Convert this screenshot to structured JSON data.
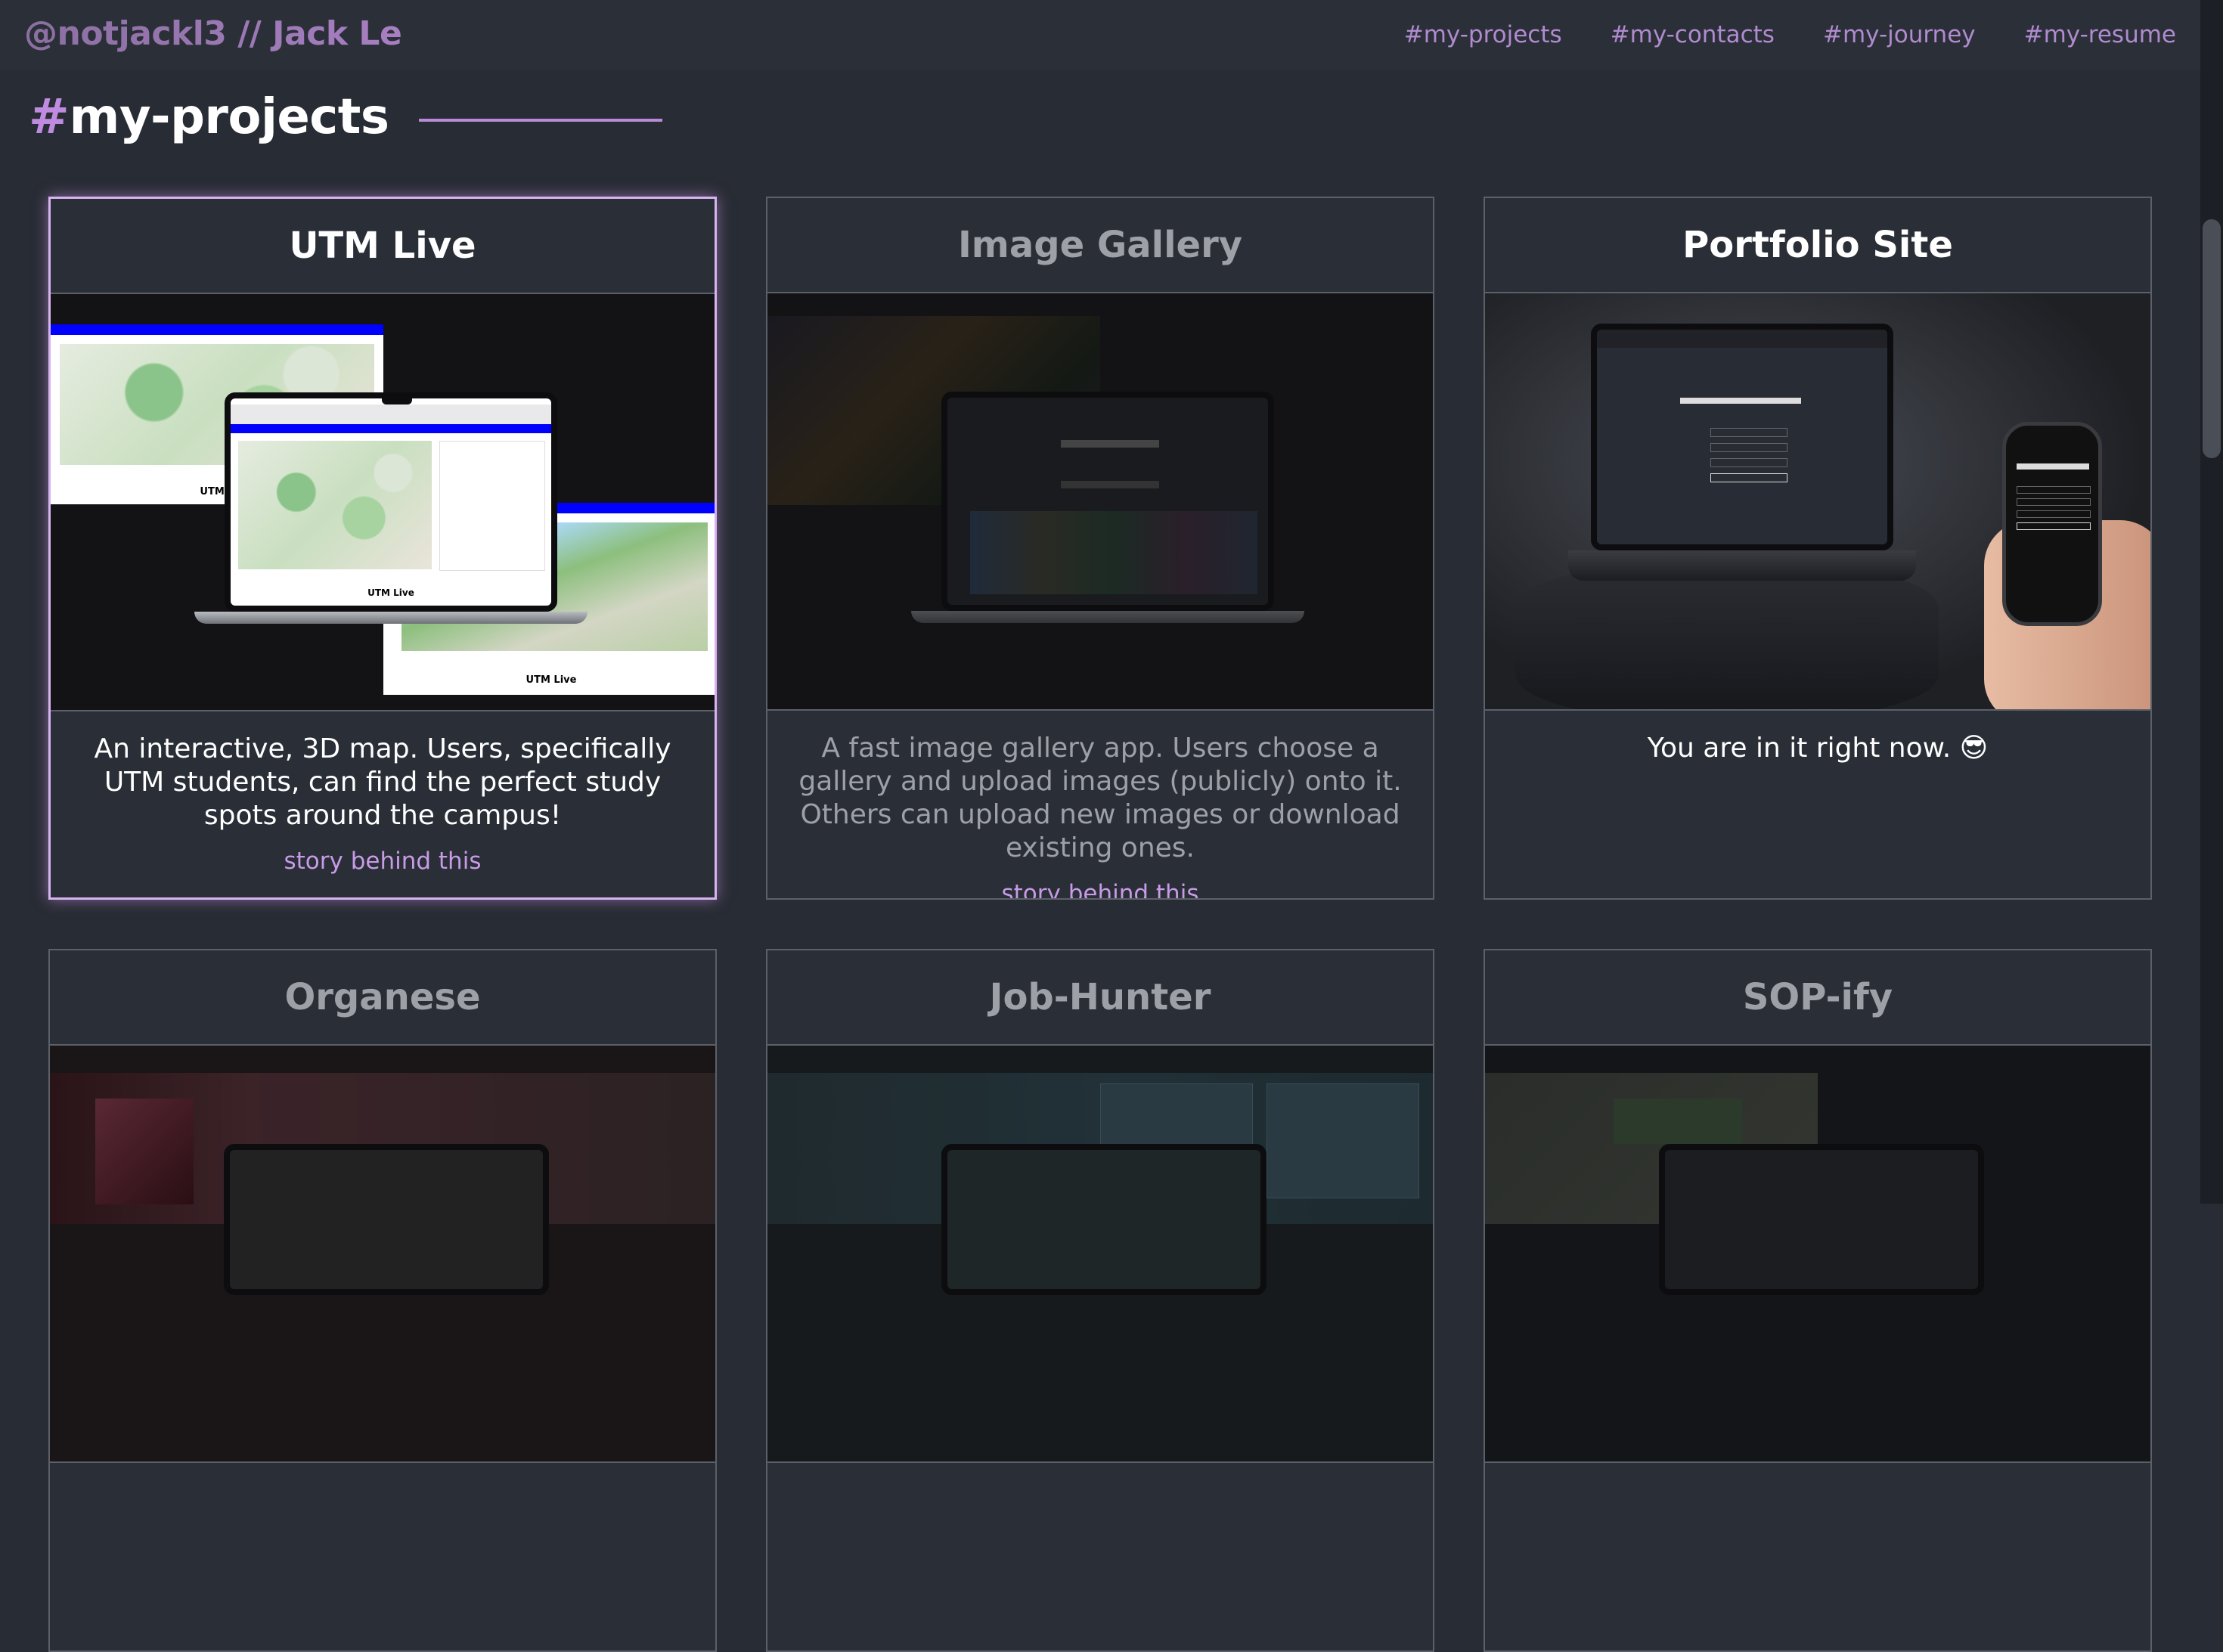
{
  "header": {
    "brand": "@notjackl3 // Jack Le",
    "nav": [
      "#my-projects",
      "#my-contacts",
      "#my-journey",
      "#my-resume"
    ]
  },
  "section": {
    "hash": "#",
    "title": "my-projects"
  },
  "cards": [
    {
      "title": "UTM Live",
      "description": "An interactive, 3D map. Users, specifically UTM students, can find the perfect study spots around the campus!",
      "link": "story behind this",
      "image_labels": [
        "UTM Live",
        "UTM Live",
        "UTM L"
      ],
      "state": "highlighted"
    },
    {
      "title": "Image Gallery",
      "description": "A fast image gallery app. Users choose a gallery and upload images (publicly) onto it. Others can upload new images or download existing ones.",
      "link": "story behind this",
      "state": "dimmed"
    },
    {
      "title": "Portfolio Site",
      "description": "You are in it right now. 😎",
      "state": "normal"
    },
    {
      "title": "Organese",
      "state": "dimmed"
    },
    {
      "title": "Job-Hunter",
      "state": "dimmed"
    },
    {
      "title": "SOP-ify",
      "state": "dimmed"
    }
  ],
  "colors": {
    "background": "#282c34",
    "accent": "#bf8be0",
    "border": "#5c6069"
  }
}
